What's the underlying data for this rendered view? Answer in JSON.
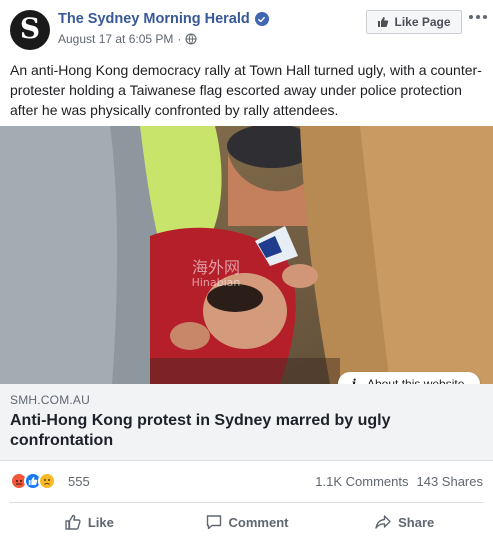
{
  "header": {
    "page_name": "The Sydney Morning Herald",
    "avatar_letter": "S",
    "timestamp": "August 17 at 6:05 PM",
    "separator": "·",
    "like_page_label": "Like Page",
    "icons": [
      "verified-badge-icon",
      "globe-icon",
      "thumbs-up-icon",
      "more-options-icon"
    ]
  },
  "post": {
    "text": "An anti-Hong Kong democracy rally at Town Hall turned ugly, with a counter-protester holding a Taiwanese flag escorted away under police protection after he was physically confronted by rally attendees."
  },
  "media": {
    "watermark_chinese": "海外网",
    "watermark_pinyin": "Hinabian",
    "about_label": "About this website"
  },
  "link": {
    "domain": "SMH.COM.AU",
    "title": "Anti-Hong Kong protest in Sydney marred by ugly confrontation"
  },
  "stats": {
    "reaction_count": "555",
    "comments": "1.1K Comments",
    "shares": "143 Shares",
    "reaction_icons": [
      "angry",
      "like",
      "sad"
    ]
  },
  "actions": {
    "like": "Like",
    "comment": "Comment",
    "share": "Share"
  },
  "colors": {
    "link_blue": "#385898",
    "verified_blue": "#4267b2",
    "text": "#1c1e21",
    "muted": "#606770",
    "link_box_bg": "#f2f3f5"
  }
}
